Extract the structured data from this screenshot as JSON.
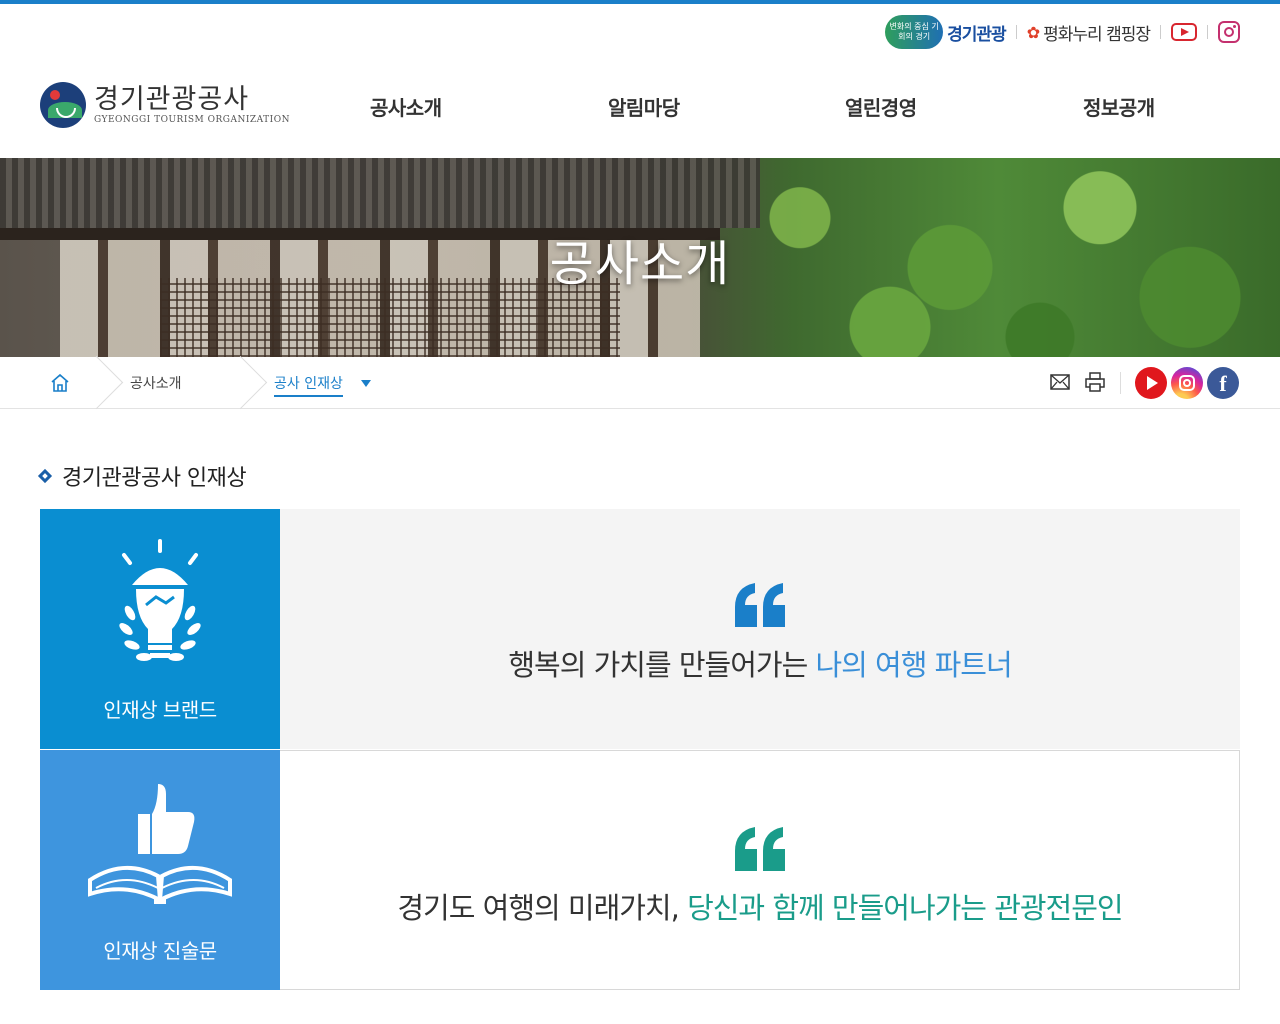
{
  "utility": {
    "badge_text": "변화의 중심 기회의 경기",
    "brand_text": "경기관광",
    "camping_text": "평화누리 캠핑장",
    "icons": [
      "youtube-icon",
      "instagram-icon"
    ]
  },
  "header": {
    "logo_ko": "경기관광공사",
    "logo_en": "GYEONGGI TOURISM ORGANIZATION",
    "nav": [
      "공사소개",
      "알림마당",
      "열린경영",
      "정보공개"
    ]
  },
  "hero": {
    "title": "공사소개"
  },
  "breadcrumb": {
    "level1": "공사소개",
    "level2": "공사 인재상"
  },
  "section": {
    "title": "경기관광공사 인재상"
  },
  "cards": [
    {
      "label": "인재상 브랜드",
      "text_plain": "행복의 가치를 만들어가는 ",
      "text_highlight": "나의 여행 파트너",
      "icon": "lightbulb-handshake-icon",
      "side_color": "#0a8ed1",
      "quote_color": "#1a7fc9"
    },
    {
      "label": "인재상 진술문",
      "text_plain": "경기도 여행의 미래가치, ",
      "text_highlight": "당신과 함께 만들어나가는 관광전문인",
      "icon": "thumbs-up-book-icon",
      "side_color": "#3e95de",
      "quote_color": "#1a9c8a"
    }
  ],
  "colors": {
    "accent": "#1a7fc9",
    "highlight_blue": "#3a8fd8",
    "highlight_teal": "#1a9c8a"
  }
}
